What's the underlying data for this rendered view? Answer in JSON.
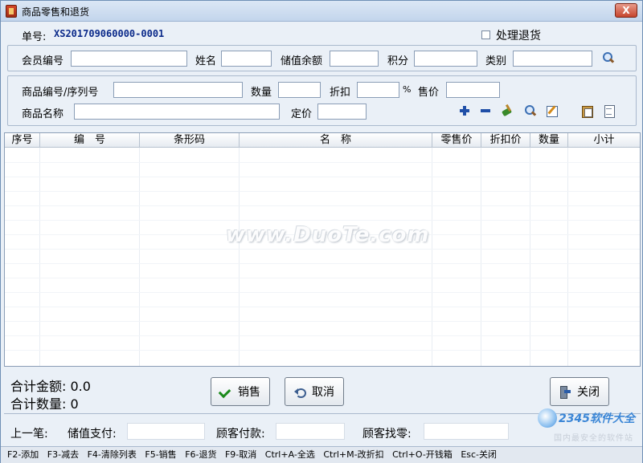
{
  "window": {
    "title": "商品零售和退货",
    "close_label": "X"
  },
  "header": {
    "order_label": "单号:",
    "order_no": "XS201709060000-0001",
    "return_label": "处理退货",
    "return_checked": false
  },
  "member": {
    "member_no_label": "会员编号",
    "name_label": "姓名",
    "balance_label": "储值余额",
    "points_label": "积分",
    "category_label": "类别"
  },
  "product": {
    "code_label": "商品编号/序列号",
    "qty_label": "数量",
    "discount_label": "折扣",
    "percent_symbol": "%",
    "price_label": "售价",
    "name_label": "商品名称",
    "list_price_label": "定价"
  },
  "grid": {
    "columns": [
      "序号",
      "编　号",
      "条形码",
      "名　称",
      "零售价",
      "折扣价",
      "数量",
      "小计"
    ],
    "rows": []
  },
  "totals": {
    "amount_label": "合计金额:",
    "amount_value": "0.0",
    "qty_label": "合计数量:",
    "qty_value": "0"
  },
  "buttons": {
    "sell": "销售",
    "cancel": "取消",
    "close": "关闭"
  },
  "last": {
    "label": "上一笔:",
    "stored_pay_label": "储值支付:",
    "customer_pay_label": "顾客付款:",
    "change_label": "顾客找零:"
  },
  "watermark": "www.DuoTe.com",
  "brand": {
    "text": "2345软件大全",
    "sub": "国内最安全的软件站"
  },
  "shortcuts": [
    "F2-添加",
    "F3-减去",
    "F4-清除列表",
    "F5-销售",
    "F6-退货",
    "F9-取消",
    "Ctrl+A-全选",
    "Ctrl+M-改折扣",
    "Ctrl+O-开钱箱",
    "Esc-关闭"
  ]
}
